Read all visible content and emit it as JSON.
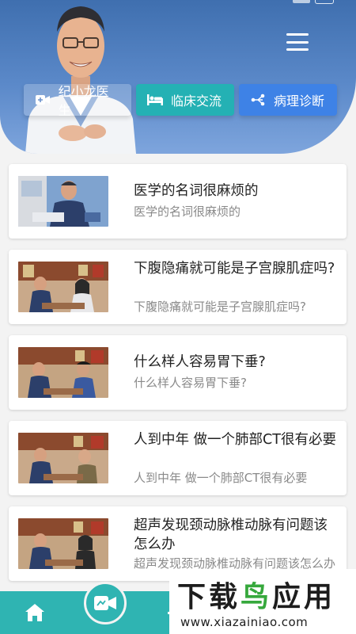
{
  "header": {
    "tabs": [
      {
        "label": "纪小龙医生",
        "icon": "video-plus-icon"
      },
      {
        "label": "临床交流",
        "icon": "bed-icon"
      },
      {
        "label": "病理诊断",
        "icon": "network-icon"
      }
    ],
    "menu_icon": "hamburger-menu-icon"
  },
  "articles": [
    {
      "title": "医学的名词很麻烦的",
      "subtitle": "医学的名词很麻烦的"
    },
    {
      "title": "下腹隐痛就可能是子宫腺肌症吗?",
      "subtitle": "下腹隐痛就可能是子宫腺肌症吗?"
    },
    {
      "title": "什么样人容易胃下垂?",
      "subtitle": "什么样人容易胃下垂?"
    },
    {
      "title": "人到中年 做一个肺部CT很有必要",
      "subtitle": "人到中年 做一个肺部CT很有必要"
    },
    {
      "title": "超声发现颈动脉椎动脉有问题该怎么办",
      "subtitle": "超声发现颈动脉椎动脉有问题该怎么办"
    }
  ],
  "bottom_nav": {
    "items": [
      {
        "icon": "home-icon"
      },
      {
        "icon": "video-camera-icon"
      }
    ]
  },
  "watermark": {
    "logo_text_a": "下载",
    "logo_text_b": "鸟",
    "logo_text_c": "应用",
    "url": "www.xiazainiao.com"
  },
  "colors": {
    "header_top": "#3f6faf",
    "teal": "#24b1b4",
    "blue": "#3e82e6",
    "nav": "#2fb4b2"
  }
}
